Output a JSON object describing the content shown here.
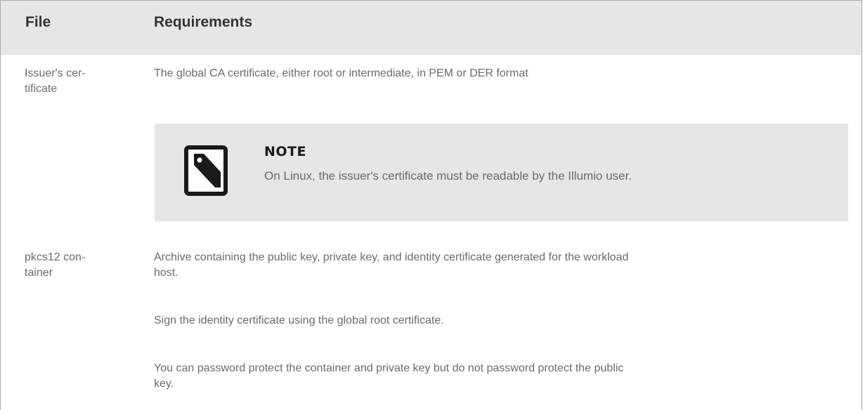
{
  "table": {
    "headers": {
      "file": "File",
      "requirements": "Requirements"
    },
    "rows": [
      {
        "file_line1": "Issuer's cer-",
        "file_line2": "tificate",
        "requirement": "The global CA certificate, either root or intermediate, in PEM or DER format",
        "note": {
          "icon": "note-icon",
          "title": "NOTE",
          "text": "On Linux, the issuer's certificate must be readable by the Illumio user."
        }
      },
      {
        "file_line1": "pkcs12 con-",
        "file_line2": "tainer",
        "paragraphs": [
          {
            "line1": "Archive containing the public key, private key, and identity certificate generated for the workload",
            "line2": "host."
          },
          {
            "line1": "Sign the identity certificate using the global root certificate."
          },
          {
            "line1": "You can password protect the container and private key but do not password protect the public",
            "line2": "key."
          }
        ]
      }
    ]
  },
  "colors": {
    "header_bg": "#e6e6e6",
    "note_bg": "#e6e6e6",
    "body_text": "#6b6b6b",
    "header_text": "#333333"
  }
}
